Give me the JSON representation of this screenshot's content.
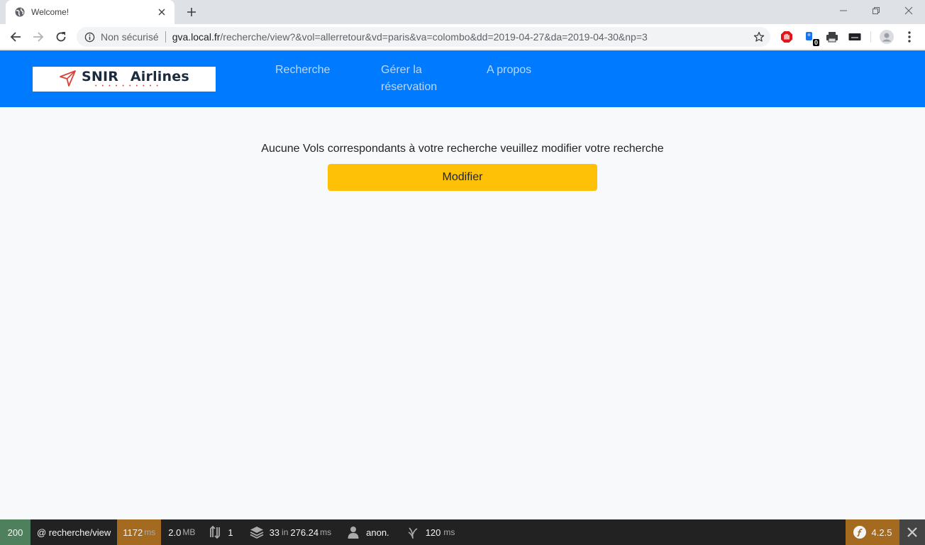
{
  "browser": {
    "tab_title": "Welcome!",
    "security_label": "Non sécurisé",
    "url_host": "gva.local.fr",
    "url_path": "/recherche/view?&vol=allerretour&vd=paris&va=colombo&dd=2019-04-27&da=2019-04-30&np=3",
    "extension_badge": "0",
    "icons": [
      "globe-icon",
      "close-icon",
      "plus-icon",
      "minimize-icon",
      "restore-icon",
      "back-icon",
      "forward-icon",
      "reload-icon",
      "info-icon",
      "star-icon",
      "adblock-icon",
      "extension-icon",
      "printer-icon",
      "keyboard-icon",
      "profile-icon",
      "menu-icon"
    ]
  },
  "site": {
    "brand": "SNIR Airlines",
    "brand_dots": "• • • • • • • • • •",
    "nav": [
      "Recherche",
      "Gérer la réservation",
      "A propos"
    ],
    "colors": {
      "header": "#007bff",
      "button": "#ffc107",
      "nav_text": "#b8d8ff"
    }
  },
  "main": {
    "message": "Aucune Vols correspondants à votre recherche veuillez modifier votre recherche",
    "button_label": "Modifier"
  },
  "debug_toolbar": {
    "status_code": "200",
    "route": "@ recherche/view",
    "time_value": "1172",
    "time_unit": "ms",
    "memory_value": "2.0",
    "memory_unit": "MB",
    "requests": "1",
    "templates_count": "33",
    "templates_in": "in",
    "templates_time": "276.24",
    "templates_unit": "ms",
    "user": "anon.",
    "render_time": "120",
    "render_unit": "ms",
    "symfony_version": "4.2.5",
    "colors": {
      "status": "#4f805d",
      "time": "#a46a1f",
      "bar": "#222222"
    }
  }
}
